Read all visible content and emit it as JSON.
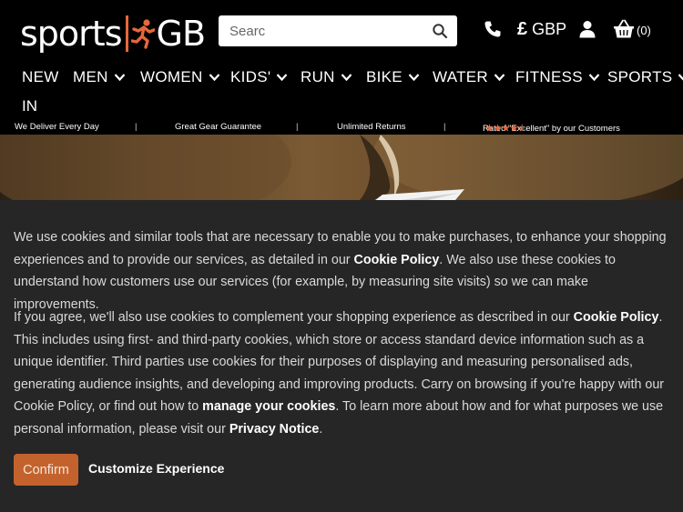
{
  "header": {
    "logo": {
      "text_left": "sports",
      "text_right": "GB"
    },
    "search": {
      "placeholder": "Searc"
    },
    "currency": {
      "symbol": "£",
      "code": "GBP"
    },
    "basket": {
      "count": "(0)"
    },
    "icons": {
      "search": "search-icon",
      "phone": "phone-icon",
      "user": "user-icon",
      "basket": "basket-icon"
    }
  },
  "nav": {
    "items": [
      {
        "label": "NEW"
      },
      {
        "label": "MEN"
      },
      {
        "label": "WOMEN"
      },
      {
        "label": "KIDS'"
      },
      {
        "label": "RUN"
      },
      {
        "label": "BIKE"
      },
      {
        "label": "WATER"
      },
      {
        "label": "FITNESS"
      },
      {
        "label": "SPORTS"
      }
    ],
    "wrap_label": "IN"
  },
  "usp": {
    "items": [
      "We Deliver Every Day",
      "Great Gear Guarantee",
      "Unlimited Returns",
      "Rated \"Excellent\" by our Customers"
    ],
    "separator": "|",
    "rating_stars": 4.5,
    "star_color": "#e8673a"
  },
  "cookie": {
    "p1_a": "We use cookies and similar tools that are necessary to enable you to make purchases, to enhance your shopping experiences and to provide our services, as detailed in our ",
    "p1_link": "Cookie Policy",
    "p1_b": ". We also use these cookies to understand how customers use our services (for example, by measuring site visits) so we can make improvements.",
    "p2_a": "If you agree, we'll also use cookies to complement your shopping experience as described in our ",
    "p2_link1": "Cookie Policy",
    "p2_b": ". This includes using first- and third-party cookies, which store or access standard device information such as a unique identifier. Third parties use cookies for their purposes of displaying and measuring personalised ads, generating audience insights, and developing and improving products. Carry on browsing if you're happy with our Cookie Policy, or find out how to ",
    "p2_link2": "manage your cookies",
    "p2_c": ". To learn more about how and for what purposes we use personal information, please visit our ",
    "p2_link3": "Privacy Notice",
    "p2_d": ".",
    "confirm_label": "Confirm",
    "customize_label": "Customize Experience"
  },
  "colors": {
    "accent": "#e8673a",
    "confirm_button": "#c4622d",
    "banner_bg": "#262626",
    "header_bg": "#000000"
  }
}
